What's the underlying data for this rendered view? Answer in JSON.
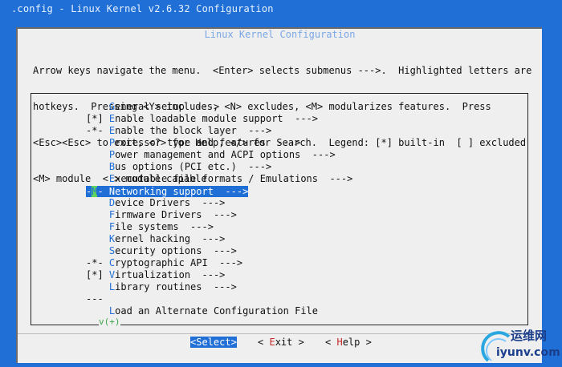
{
  "window": {
    "title": ".config - Linux Kernel v2.6.32 Configuration"
  },
  "dialog": {
    "title": "Linux Kernel Configuration",
    "help_lines": [
      "Arrow keys navigate the menu.  <Enter> selects submenus --->.  Highlighted letters are",
      "hotkeys.  Pressing <Y> includes, <N> excludes, <M> modularizes features.  Press",
      "<Esc><Esc> to exit, <?> for Help, </> for Search.  Legend: [*] built-in  [ ] excluded",
      "<M> module  < > module capable"
    ]
  },
  "menu": {
    "items": [
      {
        "prefix": "    ",
        "hot": "G",
        "rest": "eneral setup  --->"
      },
      {
        "prefix": "[*] ",
        "hot": "E",
        "rest": "nable loadable module support  --->"
      },
      {
        "prefix": "-*- ",
        "hot": "E",
        "rest": "nable the block layer  --->"
      },
      {
        "prefix": "    ",
        "hot": "P",
        "rest": "rocessor type and features  --->"
      },
      {
        "prefix": "    ",
        "hot": "P",
        "rest": "ower management and ACPI options  --->"
      },
      {
        "prefix": "    ",
        "hot": "B",
        "rest": "us options (PCI etc.)  --->"
      },
      {
        "prefix": "    ",
        "hot": "E",
        "rest": "xecutable file formats / Emulations  --->"
      },
      {
        "prefix_a": "-",
        "box": "M",
        "prefix_b": "- ",
        "hot": "N",
        "rest": "etworking support  --->",
        "selected": true
      },
      {
        "prefix": "    ",
        "hot": "D",
        "rest": "evice Drivers  --->"
      },
      {
        "prefix": "    ",
        "hot": "F",
        "rest": "irmware Drivers  --->"
      },
      {
        "prefix": "    ",
        "hot": "F",
        "rest": "ile systems  --->"
      },
      {
        "prefix": "    ",
        "hot": "K",
        "rest": "ernel hacking  --->"
      },
      {
        "prefix": "    ",
        "hot": "S",
        "rest": "ecurity options  --->"
      },
      {
        "prefix": "-*- ",
        "hot": "C",
        "rest": "ryptographic API  --->"
      },
      {
        "prefix": "[*] ",
        "hot": "V",
        "rest": "irtualization  --->"
      },
      {
        "prefix": "    ",
        "hot": "L",
        "rest": "ibrary routines  --->"
      },
      {
        "prefix": "--- ",
        "hot": "",
        "rest": ""
      },
      {
        "prefix": "    ",
        "hot": "L",
        "rest": "oad an Alternate Configuration File"
      }
    ],
    "scroll_indicator": "v(+)"
  },
  "buttons": {
    "select": {
      "open": "<",
      "hot": "S",
      "rest": "elect>"
    },
    "exit": {
      "open": "< ",
      "hot": "E",
      "rest": "xit >"
    },
    "help": {
      "open": "< ",
      "hot": "H",
      "rest": "elp >"
    }
  },
  "watermark": {
    "cn": "运维网",
    "url": "iyunv.com"
  }
}
